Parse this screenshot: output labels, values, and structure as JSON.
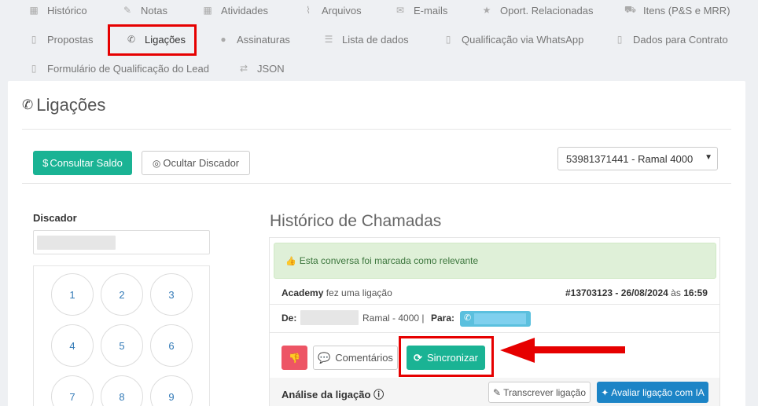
{
  "tabs_row1": [
    {
      "label": "Histórico",
      "icon": "calendar-icon"
    },
    {
      "label": "Notas",
      "icon": "edit-icon"
    },
    {
      "label": "Atividades",
      "icon": "calendar-icon"
    },
    {
      "label": "Arquivos",
      "icon": "paperclip-icon"
    },
    {
      "label": "E-mails",
      "icon": "envelope-icon"
    },
    {
      "label": "Oport. Relacionadas",
      "icon": "star-icon"
    },
    {
      "label": "Itens (P&S e MRR)",
      "icon": "cart-icon"
    }
  ],
  "tabs_row2": [
    {
      "label": "Propostas",
      "icon": "file-icon"
    },
    {
      "label": "Ligações",
      "icon": "phone-icon"
    },
    {
      "label": "Assinaturas",
      "icon": "check-circle-icon"
    },
    {
      "label": "Lista de dados",
      "icon": "list-icon"
    },
    {
      "label": "Qualificação via WhatsApp",
      "icon": "file-icon"
    },
    {
      "label": "Dados para Contrato",
      "icon": "file-icon"
    }
  ],
  "tabs_row3": [
    {
      "label": "Formulário de Qualificação do Lead",
      "icon": "file-icon"
    },
    {
      "label": "JSON",
      "icon": "exchange-icon"
    }
  ],
  "section": {
    "title": "Ligações"
  },
  "toolbar": {
    "consultar_saldo": "Consultar Saldo",
    "ocultar_discador": "Ocultar Discador",
    "ramal_select": "53981371441 - Ramal 4000"
  },
  "discador": {
    "label": "Discador",
    "keys": [
      "1",
      "2",
      "3",
      "4",
      "5",
      "6",
      "7",
      "8",
      "9"
    ]
  },
  "historico": {
    "title": "Histórico de Chamadas",
    "alert": "Esta conversa foi marcada como relevante",
    "caller": "Academy",
    "action_text": "fez uma ligação",
    "call_id": "#13703123",
    "sep": "-",
    "date": "26/08/2024",
    "at": "às",
    "time": "16:59",
    "de_label": "De:",
    "ramal": "Ramal - 4000 |",
    "para_label": "Para:",
    "comentarios": "Comentários",
    "sincronizar": "Sincronizar",
    "analise_label": "Análise da ligação",
    "transcrever": "Transcrever ligação",
    "avaliar": "Avaliar ligação com IA"
  },
  "colors": {
    "green": "#1ab394",
    "blue": "#1c84c6",
    "red": "#ed5565",
    "highlight": "#e60000"
  }
}
